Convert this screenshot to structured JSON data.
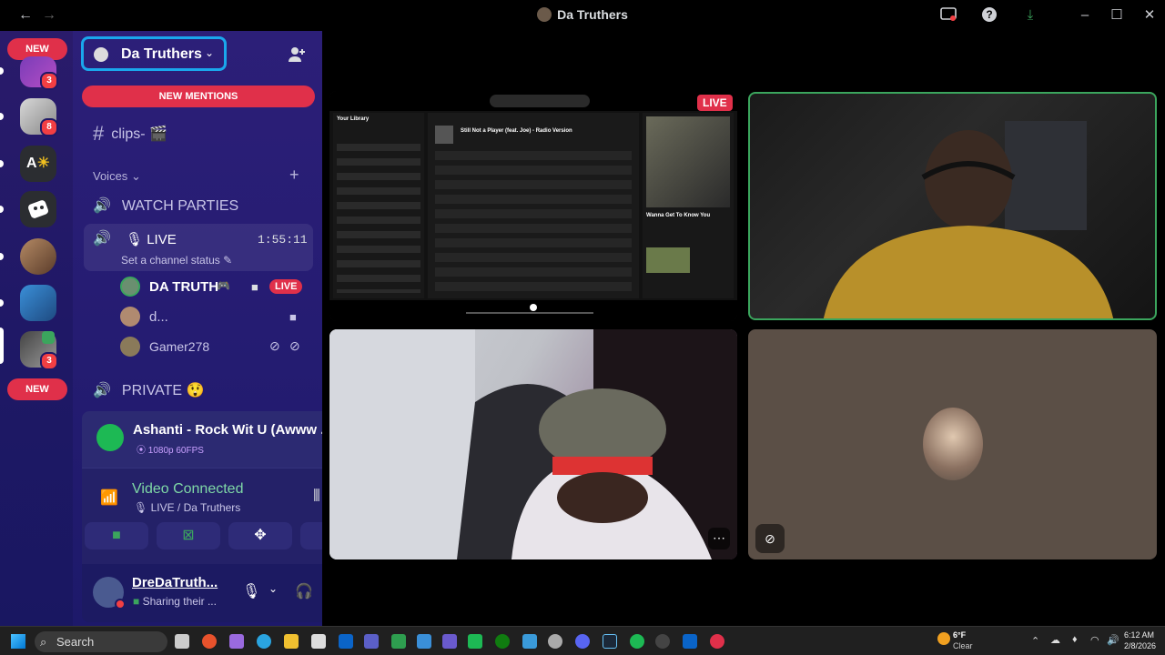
{
  "window": {
    "title": "Da Truthers"
  },
  "rail": {
    "new_top": "NEW",
    "new_bottom": "NEW",
    "badges": [
      "3",
      "8",
      "3"
    ],
    "text_server": "A"
  },
  "guild": {
    "name": "Da Truthers"
  },
  "channels": {
    "new_mentions": "NEW MENTIONS",
    "clips": "clips-",
    "voices_label": "Voices",
    "watch_parties": "WATCH PARTIES",
    "live_channel": "LIVE",
    "live_timer": "1:55:11",
    "channel_status": "Set a channel status",
    "private": "PRIVATE"
  },
  "voice_users": [
    {
      "name": "DA TRUTH",
      "live": "LIVE"
    },
    {
      "name": "d..."
    },
    {
      "name": "Gamer278"
    }
  ],
  "activity": {
    "title": "Ashanti - Rock Wit U (Awww ...",
    "quality": "1080p 60FPS"
  },
  "voice": {
    "status": "Video Connected",
    "location": "LIVE / Da Truthers"
  },
  "user": {
    "name": "DreDaTruth...",
    "status": "Sharing their ..."
  },
  "stage": {
    "live_badge": "LIVE",
    "spotify": {
      "library": "Your Library",
      "now_playing": "Still Not a Player (feat. Joe) - Radio Version",
      "side_title": "Wanna Get To Know You"
    }
  },
  "taskbar": {
    "search": "Search",
    "weather_temp": "6°F",
    "weather_desc": "Clear",
    "time": "6:12 AM",
    "date": "2/8/2026"
  }
}
